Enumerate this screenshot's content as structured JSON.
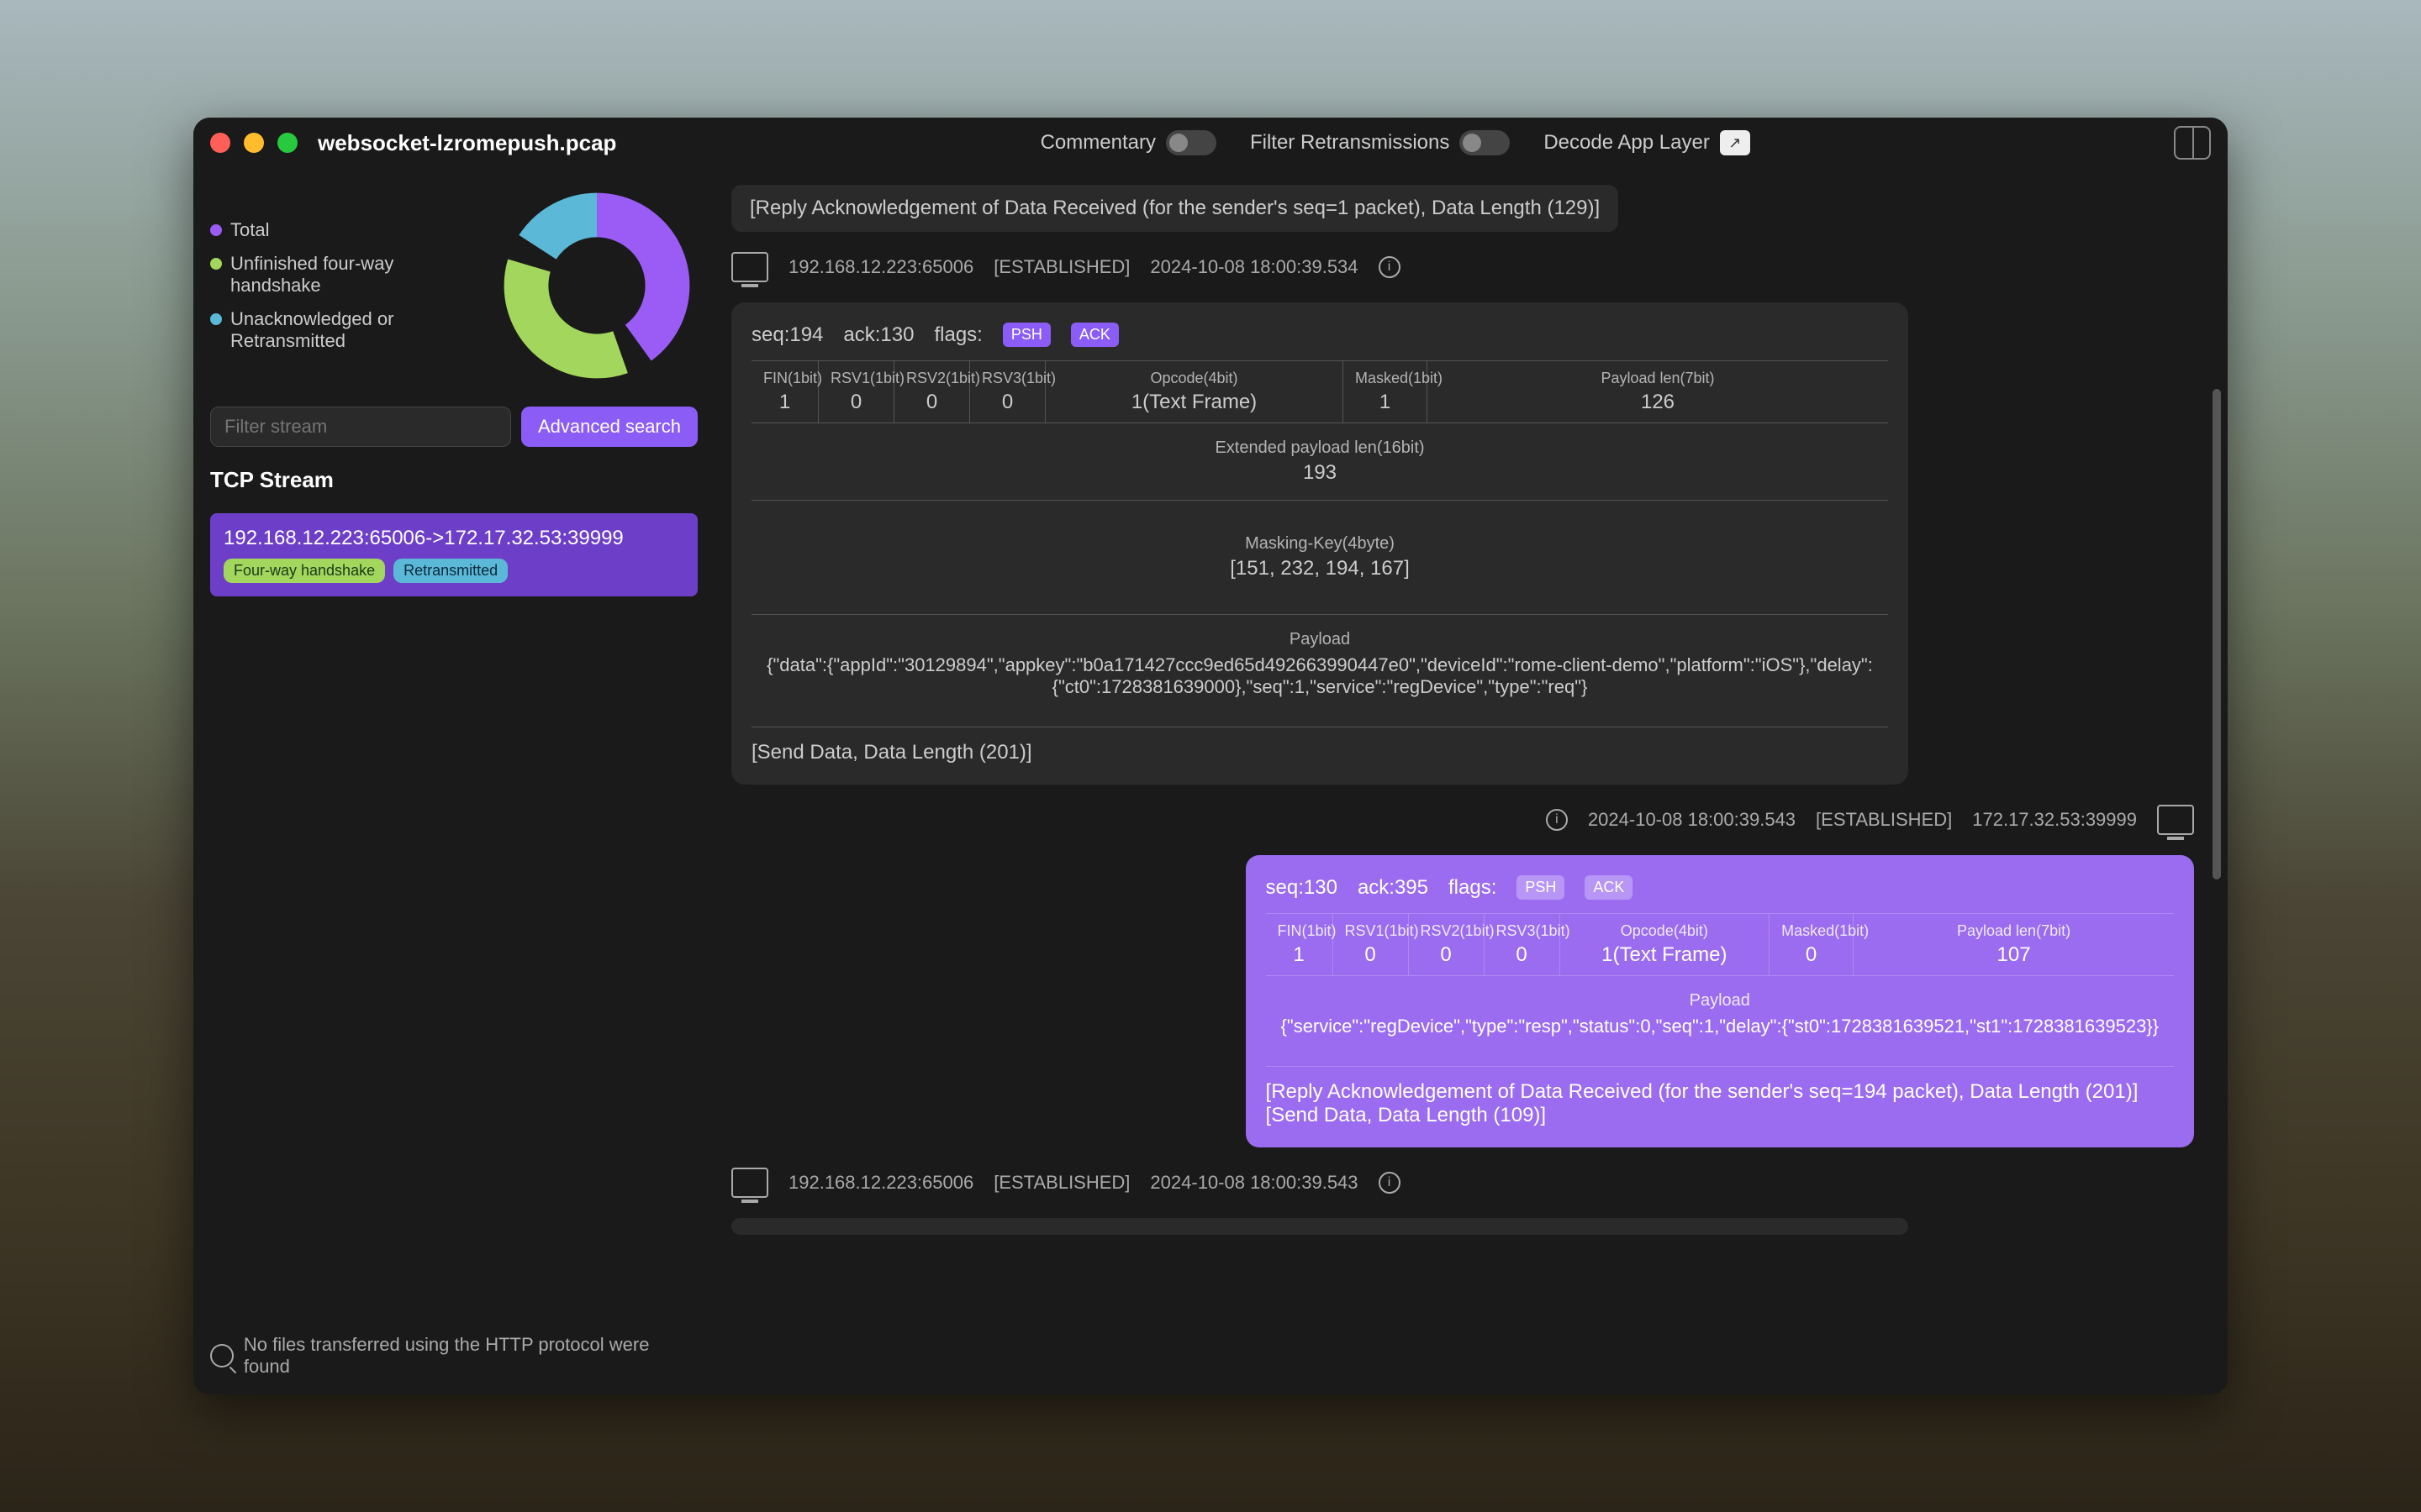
{
  "window": {
    "title": "websocket-lzromepush.pcap"
  },
  "toolbar": {
    "commentary": "Commentary",
    "filter_retrans": "Filter Retransmissions",
    "decode_app": "Decode App Layer"
  },
  "legend": {
    "total": "Total",
    "unfinished": "Unfinished four-way handshake",
    "unack": "Unacknowledged or Retransmitted"
  },
  "chart_data": {
    "type": "pie",
    "title": "",
    "series": [
      {
        "name": "Total",
        "value": 40,
        "color": "#9b5cf6"
      },
      {
        "name": "Unfinished four-way handshake",
        "value": 35,
        "color": "#a3d65c"
      },
      {
        "name": "Unacknowledged or Retransmitted",
        "value": 25,
        "color": "#5bb8d6"
      }
    ]
  },
  "sidebar": {
    "filter_placeholder": "Filter stream",
    "adv_search": "Advanced search",
    "section": "TCP Stream",
    "stream": {
      "label": "192.168.12.223:65006->172.17.32.53:39999",
      "tag1": "Four-way handshake",
      "tag2": "Retransmitted"
    },
    "bottom": "No files transferred using the HTTP protocol were found"
  },
  "top_summary": "[Reply Acknowledgement of Data Received (for the sender's seq=1 packet), Data Length (129)]",
  "meta1": {
    "addr": "192.168.12.223:65006",
    "state": "[ESTABLISHED]",
    "time": "2024-10-08 18:00:39.534"
  },
  "pkt1": {
    "seq": "seq:194",
    "ack": "ack:130",
    "flags_label": "flags:",
    "flag_psh": "PSH",
    "flag_ack": "ACK",
    "fin_h": "FIN(1bit)",
    "fin_v": "1",
    "rsv1_h": "RSV1(1bit)",
    "rsv1_v": "0",
    "rsv2_h": "RSV2(1bit)",
    "rsv2_v": "0",
    "rsv3_h": "RSV3(1bit)",
    "rsv3_v": "0",
    "op_h": "Opcode(4bit)",
    "op_v": "1(Text Frame)",
    "mask_h": "Masked(1bit)",
    "mask_v": "1",
    "plen_h": "Payload len(7bit)",
    "plen_v": "126",
    "ext_h": "Extended payload len(16bit)",
    "ext_v": "193",
    "mkey_h": "Masking-Key(4byte)",
    "mkey_v": "[151, 232, 194, 167]",
    "pay_h": "Payload",
    "pay_v": "{\"data\":{\"appId\":\"30129894\",\"appkey\":\"b0a171427ccc9ed65d492663990447e0\",\"deviceId\":\"rome-client-demo\",\"platform\":\"iOS\"},\"delay\":{\"ct0\":1728381639000},\"seq\":1,\"service\":\"regDevice\",\"type\":\"req\"}",
    "footer": "[Send Data, Data Length (201)]"
  },
  "meta2": {
    "time": "2024-10-08 18:00:39.543",
    "state": "[ESTABLISHED]",
    "addr": "172.17.32.53:39999"
  },
  "pkt2": {
    "seq": "seq:130",
    "ack": "ack:395",
    "flags_label": "flags:",
    "flag_psh": "PSH",
    "flag_ack": "ACK",
    "fin_h": "FIN(1bit)",
    "fin_v": "1",
    "rsv1_h": "RSV1(1bit)",
    "rsv1_v": "0",
    "rsv2_h": "RSV2(1bit)",
    "rsv2_v": "0",
    "rsv3_h": "RSV3(1bit)",
    "rsv3_v": "0",
    "op_h": "Opcode(4bit)",
    "op_v": "1(Text Frame)",
    "mask_h": "Masked(1bit)",
    "mask_v": "0",
    "plen_h": "Payload len(7bit)",
    "plen_v": "107",
    "pay_h": "Payload",
    "pay_v": "{\"service\":\"regDevice\",\"type\":\"resp\",\"status\":0,\"seq\":1,\"delay\":{\"st0\":1728381639521,\"st1\":1728381639523}}",
    "footer1": "[Reply Acknowledgement of Data Received (for the sender's seq=194 packet), Data Length (201)]",
    "footer2": "[Send Data, Data Length (109)]"
  },
  "meta3": {
    "addr": "192.168.12.223:65006",
    "state": "[ESTABLISHED]",
    "time": "2024-10-08 18:00:39.543"
  }
}
